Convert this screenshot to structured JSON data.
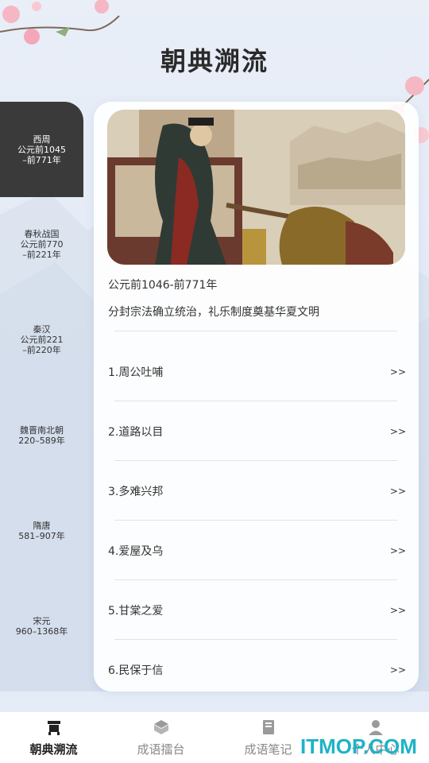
{
  "app": {
    "title": "朝典溯流"
  },
  "sidebar": {
    "items": [
      {
        "name": "西周",
        "range1": "公元前1045",
        "range2": "–前771年"
      },
      {
        "name": "春秋战国",
        "range1": "公元前770",
        "range2": "–前221年"
      },
      {
        "name": "秦汉",
        "range1": "公元前221",
        "range2": "–前220年"
      },
      {
        "name": "魏晋南北朝",
        "range1": "220–589年",
        "range2": ""
      },
      {
        "name": "隋唐",
        "range1": "581–907年",
        "range2": ""
      },
      {
        "name": "宋元",
        "range1": "960–1368年",
        "range2": ""
      }
    ]
  },
  "detail": {
    "period": "公元前1046-前771年",
    "summary": "分封宗法确立统治，礼乐制度奠基华夏文明",
    "idioms": [
      {
        "label": "1.周公吐哺",
        "arrow": ">>"
      },
      {
        "label": "2.道路以目",
        "arrow": ">>"
      },
      {
        "label": "3.多难兴邦",
        "arrow": ">>"
      },
      {
        "label": "4.爱屋及乌",
        "arrow": ">>"
      },
      {
        "label": "5.甘棠之爱",
        "arrow": ">>"
      },
      {
        "label": "6.民保于信",
        "arrow": ">>"
      }
    ]
  },
  "nav": {
    "items": [
      {
        "label": "朝典溯流",
        "icon": "dynasty-icon"
      },
      {
        "label": "成语擂台",
        "icon": "arena-icon"
      },
      {
        "label": "成语笔记",
        "icon": "notebook-icon"
      },
      {
        "label": "个人中心",
        "icon": "person-icon"
      }
    ]
  },
  "watermark": "ITMOP.COM",
  "colors": {
    "active_sidebar": "#3a3a3a",
    "watermark": "#1db3c7"
  }
}
